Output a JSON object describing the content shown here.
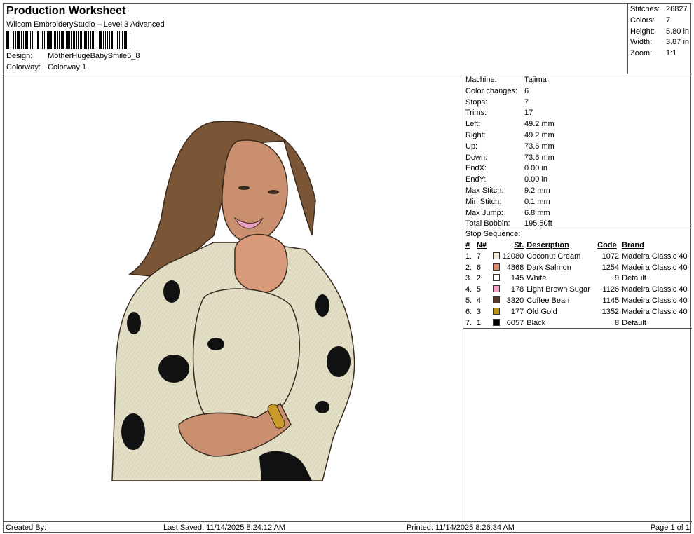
{
  "header": {
    "title": "Production Worksheet",
    "subtitle": "Wilcom EmbroideryStudio – Level 3 Advanced",
    "design_label": "Design:",
    "design_value": "MotherHugeBabySmile5_8",
    "colorway_label": "Colorway:",
    "colorway_value": "Colorway 1"
  },
  "summary": [
    {
      "label": "Stitches:",
      "value": "26827"
    },
    {
      "label": "Colors:",
      "value": "7"
    },
    {
      "label": "Height:",
      "value": "5.80 in"
    },
    {
      "label": "Width:",
      "value": "3.87 in"
    },
    {
      "label": "Zoom:",
      "value": "1:1"
    }
  ],
  "machine_info": [
    {
      "label": "Machine:",
      "value": "Tajima"
    },
    {
      "label": "Color changes:",
      "value": "6"
    },
    {
      "label": "Stops:",
      "value": "7"
    },
    {
      "label": "Trims:",
      "value": "17"
    },
    {
      "label": "Left:",
      "value": "49.2 mm"
    },
    {
      "label": "Right:",
      "value": "49.2 mm"
    },
    {
      "label": "Up:",
      "value": "73.6 mm"
    },
    {
      "label": "Down:",
      "value": "73.6 mm"
    },
    {
      "label": "EndX:",
      "value": "0.00 in"
    },
    {
      "label": "EndY:",
      "value": "0.00 in"
    },
    {
      "label": "Max Stitch:",
      "value": "9.2 mm"
    },
    {
      "label": "Min Stitch:",
      "value": "0.1 mm"
    },
    {
      "label": "Max Jump:",
      "value": "6.8 mm"
    },
    {
      "label": "Total Bobbin:",
      "value": "195.50ft"
    }
  ],
  "stops": {
    "caption": "Stop Sequence:",
    "headers": {
      "seq": "#",
      "num": "N#",
      "st": "St.",
      "desc": "Description",
      "code": "Code",
      "brand": "Brand"
    },
    "rows": [
      {
        "seq": "1.",
        "num": "7",
        "color": "#f3ebd6",
        "st": "12080",
        "desc": "Coconut Cream",
        "code": "1072",
        "brand": "Madeira Classic 40"
      },
      {
        "seq": "2.",
        "num": "6",
        "color": "#d98a73",
        "st": "4868",
        "desc": "Dark Salmon",
        "code": "1254",
        "brand": "Madeira Classic 40"
      },
      {
        "seq": "3.",
        "num": "2",
        "color": "#ffffff",
        "st": "145",
        "desc": "White",
        "code": "9",
        "brand": "Default"
      },
      {
        "seq": "4.",
        "num": "5",
        "color": "#f2a0c8",
        "st": "178",
        "desc": "Light Brown Sugar",
        "code": "1126",
        "brand": "Madeira Classic 40"
      },
      {
        "seq": "5.",
        "num": "4",
        "color": "#5a3a2a",
        "st": "3320",
        "desc": "Coffee Bean",
        "code": "1145",
        "brand": "Madeira Classic 40"
      },
      {
        "seq": "6.",
        "num": "3",
        "color": "#b8901a",
        "st": "177",
        "desc": "Old Gold",
        "code": "1352",
        "brand": "Madeira Classic 40"
      },
      {
        "seq": "7.",
        "num": "1",
        "color": "#000000",
        "st": "6057",
        "desc": "Black",
        "code": "8",
        "brand": "Default"
      }
    ]
  },
  "footer": {
    "created": "Created By:",
    "saved": "Last Saved: 11/14/2025 8:24:12 AM",
    "printed": "Printed: 11/14/2025 8:26:34 AM",
    "page": "Page 1 of 1"
  },
  "design_colors": {
    "cream": "#e3dfc6",
    "hair": "#7a5636",
    "skin": "#c98f6e",
    "baby": "#d99a7a",
    "gold": "#c99a2a",
    "outline": "#3a2a1e",
    "black": "#111111"
  }
}
